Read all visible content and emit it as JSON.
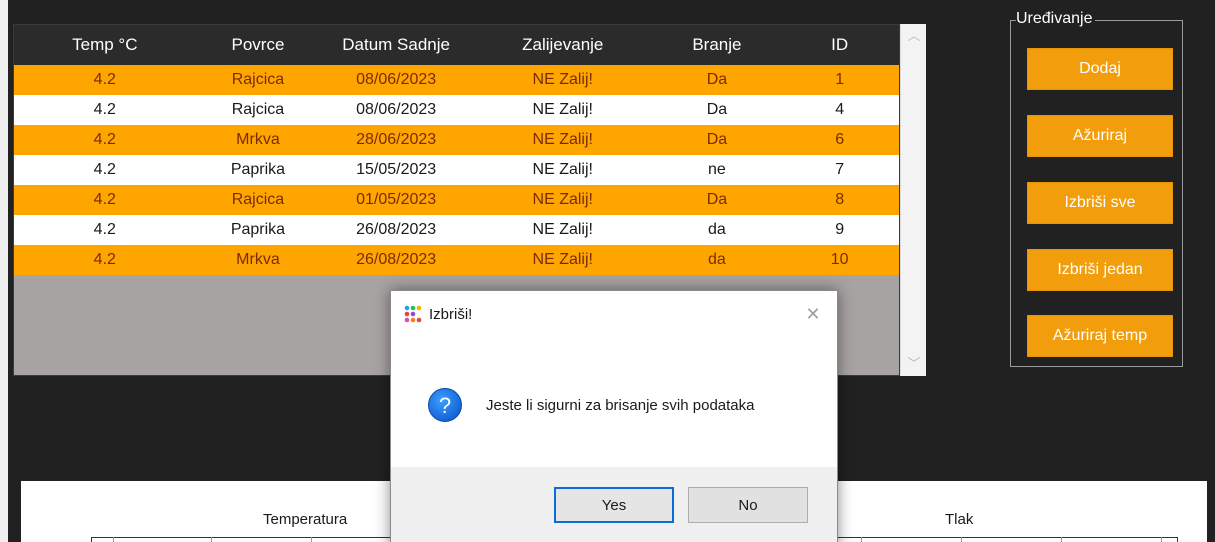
{
  "table": {
    "headers": [
      "Temp °C",
      "Povrce",
      "Datum Sadnje",
      "Zalijevanje",
      "Branje",
      "ID"
    ],
    "rows": [
      [
        "4.2",
        "Rajcica",
        "08/06/2023",
        "NE Zalij!",
        "Da",
        "1"
      ],
      [
        "4.2",
        "Rajcica",
        "08/06/2023",
        "NE Zalij!",
        "Da",
        "4"
      ],
      [
        "4.2",
        "Mrkva",
        "28/06/2023",
        "NE Zalij!",
        "Da",
        "6"
      ],
      [
        "4.2",
        "Paprika",
        "15/05/2023",
        "NE Zalij!",
        "ne",
        "7"
      ],
      [
        "4.2",
        "Rajcica",
        "01/05/2023",
        "NE Zalij!",
        "Da",
        "8"
      ],
      [
        "4.2",
        "Paprika",
        "26/08/2023",
        "NE Zalij!",
        "da",
        "9"
      ],
      [
        "4.2",
        "Mrkva",
        "26/08/2023",
        "NE Zalij!",
        "da",
        "10"
      ]
    ],
    "scroll_up_icon": "chevron-up-icon",
    "scroll_down_icon": "chevron-down-icon"
  },
  "edit_group": {
    "legend": "Uređivanje",
    "buttons": [
      "Dodaj",
      "Ažuriraj",
      "Izbriši sve",
      "Izbriši jedan",
      "Ažuriraj temp"
    ]
  },
  "charts": {
    "left_title": "Temperatura",
    "right_title": "Tlak"
  },
  "dialog": {
    "title": "Izbriši!",
    "message": "Jeste li sigurni za brisanje svih podataka",
    "yes_label": "Yes",
    "no_label": "No",
    "icon": "question-icon",
    "close_glyph": "✕"
  },
  "colors": {
    "accent_orange": "#ffa500",
    "button_orange": "#f29d0b",
    "window_dark": "#212121"
  }
}
